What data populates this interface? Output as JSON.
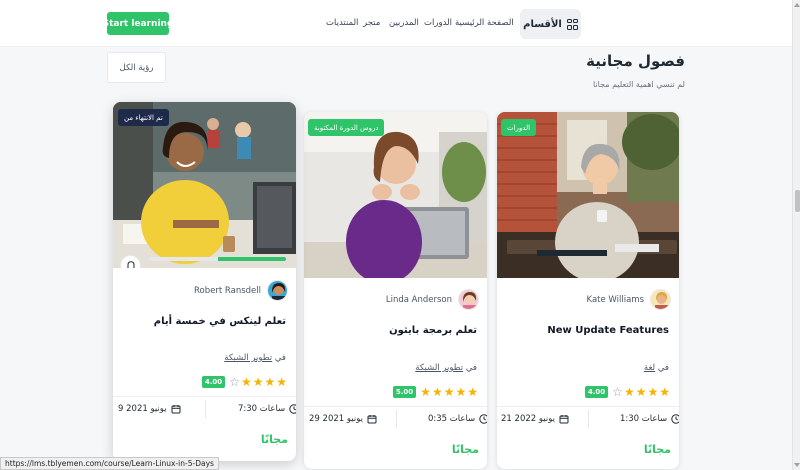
{
  "header": {
    "start_button": "Start learning",
    "nav": [
      {
        "key": "home",
        "label": "الصفحة الرئيسية"
      },
      {
        "key": "courses",
        "label": "الدورات"
      },
      {
        "key": "trainers",
        "label": "المدربين"
      },
      {
        "key": "store",
        "label": "متجر"
      },
      {
        "key": "forums",
        "label": "المنتديات"
      }
    ],
    "categories_button": "الأقسام"
  },
  "section": {
    "title": "فصول مجانية",
    "subtitle": "لم تنسي اهمية التعليم مجانا",
    "view_all": "رؤية الكل"
  },
  "cards": [
    {
      "badge": "الدورات",
      "author": "Kate Williams",
      "title": "New Update Features",
      "category_prefix": "في",
      "category": "لغة",
      "rating": "4.00",
      "stars": 4,
      "duration": "1:30 ساعات",
      "date": "21 يونيو 2022",
      "price": "مجانًا"
    },
    {
      "badge": "دروس الدورة المكتوبة",
      "author": "Linda Anderson",
      "title": "تعلم برمجة بايثون",
      "category_prefix": "في",
      "category": "تطوير الشبكة",
      "rating": "5.00",
      "stars": 5,
      "duration": "0:35 ساعات",
      "date": "29 يونيو 2021",
      "price": "مجانًا"
    },
    {
      "badge": "تم الانتهاء من",
      "author": "Robert Ransdell",
      "title": "تعلم لينكس في خمسة أيام",
      "category_prefix": "في",
      "category": "تطوير الشبكة",
      "rating": "4.00",
      "stars": 4,
      "duration": "7:30 ساعات",
      "date": "9 يونيو 2021",
      "price": "مجانًا",
      "progress": 0.5
    }
  ],
  "status_bar": {
    "url": "https://lms.tblyemen.com/course/Learn-Linux-in-5-Days"
  },
  "colors": {
    "accent": "#2fc36a",
    "star": "#f5b400",
    "badge_dark": "#1e2a4a"
  }
}
